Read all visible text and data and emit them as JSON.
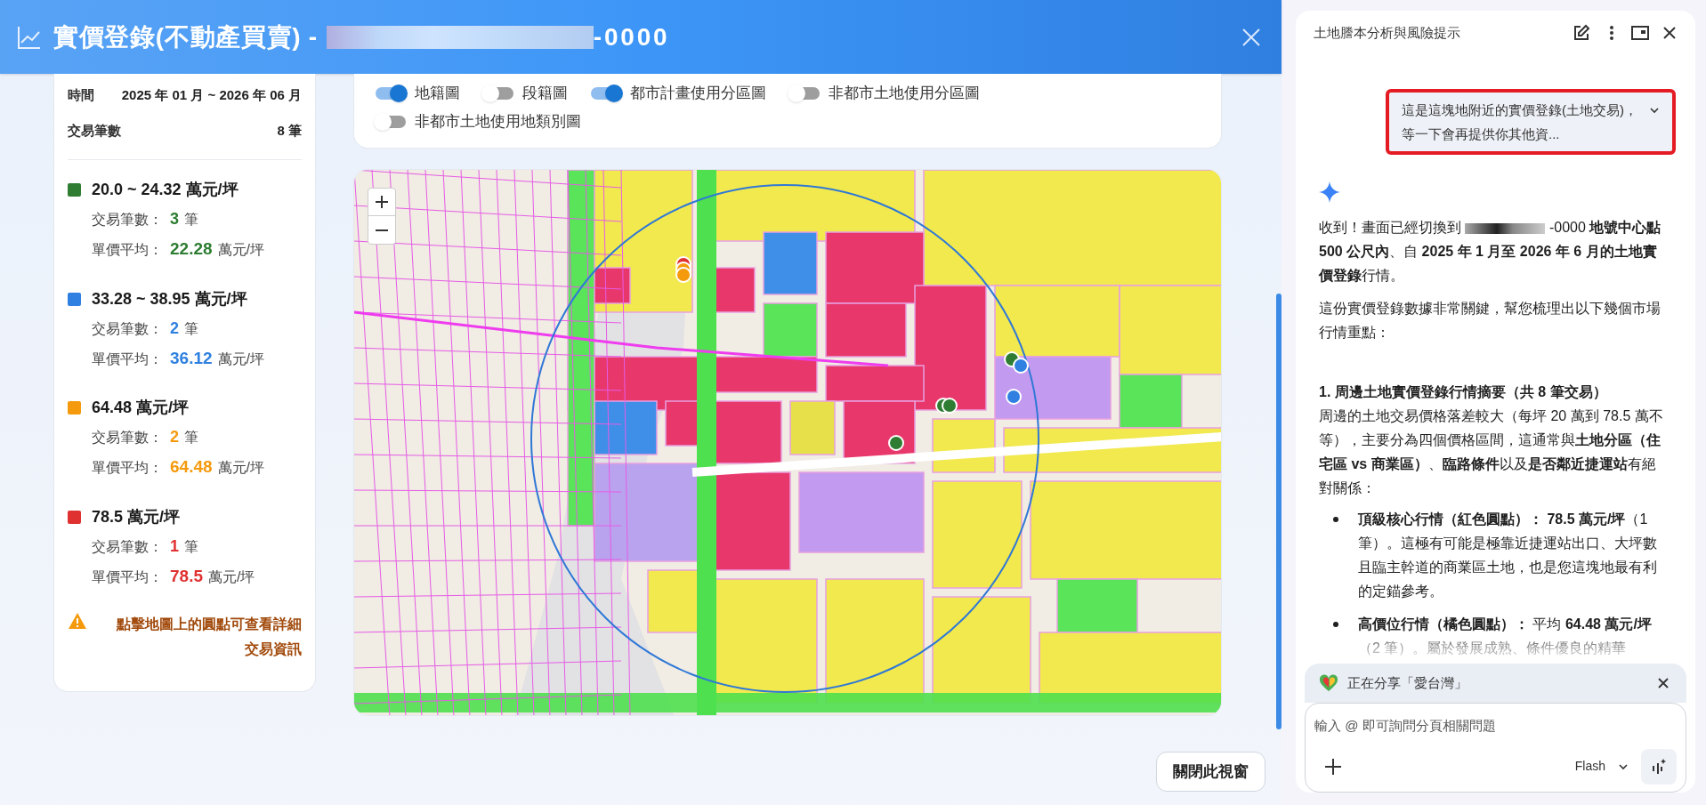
{
  "header": {
    "title": "實價登錄(不動產買賣) -",
    "title_suffix": "-0000"
  },
  "summary": [
    {
      "label": "時間",
      "value": "2025 年 01 月 ~ 2026 年 06 月"
    },
    {
      "label": "交易筆數",
      "value": "8 筆"
    }
  ],
  "legend": [
    {
      "color": "#2e7d32",
      "range": "20.0 ~ 24.32 萬元/坪",
      "count_label": "交易筆數：",
      "count": "3",
      "count_unit": "筆",
      "avg_label": "單價平均：",
      "avg": "22.28",
      "avg_unit": "萬元/坪"
    },
    {
      "color": "#2f80e0",
      "range": "33.28 ~ 38.95 萬元/坪",
      "count_label": "交易筆數：",
      "count": "2",
      "count_unit": "筆",
      "avg_label": "單價平均：",
      "avg": "36.12",
      "avg_unit": "萬元/坪"
    },
    {
      "color": "#f59a0c",
      "range": "64.48 萬元/坪",
      "count_label": "交易筆數：",
      "count": "2",
      "count_unit": "筆",
      "avg_label": "單價平均：",
      "avg": "64.48",
      "avg_unit": "萬元/坪"
    },
    {
      "color": "#e03131",
      "range": "78.5 萬元/坪",
      "count_label": "交易筆數：",
      "count": "1",
      "count_unit": "筆",
      "avg_label": "單價平均：",
      "avg": "78.5",
      "avg_unit": "萬元/坪"
    }
  ],
  "hint": "點擊地圖上的圓點可查看詳細交易資訊",
  "layers": [
    {
      "label": "地籍圖",
      "on": true
    },
    {
      "label": "段籍圖",
      "on": false
    },
    {
      "label": "都市計畫使用分區圖",
      "on": true
    },
    {
      "label": "非都市土地使用分區圖",
      "on": false
    },
    {
      "label": "非都市土地使用地類別圖",
      "on": false
    }
  ],
  "close_button": "關閉此視窗",
  "assistant": {
    "title": "土地謄本分析與風險提示",
    "user_message": "這是這塊地附近的實價登錄(土地交易)，等一下會再提供你其他資...",
    "intro_before": "收到！畫面已經切換到",
    "intro_after": "-0000 **地號中心點 500 公尺內**、自 **2025 年 1 月至 2026 年 6 月的土地實價登錄**行情。",
    "paragraph": "這份實價登錄數據非常關鍵，幫您梳理出以下幾個市場行情重點：",
    "section_heading": "1. 周邊土地實價登錄行情摘要（共 8 筆交易）",
    "section_text": "周邊的土地交易價格落差較大（每坪 20 萬到 78.5 萬不等），主要分為四個價格區間，這通常與**土地分區（住宅區 vs 商業區）**、**臨路條件**以及**是否鄰近捷運站**有絕對關係：",
    "bullets": [
      "**頂級核心行情（紅色圓點）： 78.5 萬元/坪**（1 筆）。這極有可能是極靠近捷運站出口、大坪數且臨主幹道的商業區土地，也是您這塊地最有利的定錨參考。",
      "**高價位行情（橘色圓點）：** 平均 **64.48 萬元/坪**（2 筆）。屬於發展成熟、條件優良的精華"
    ],
    "sharing": "正在分享「愛台灣」",
    "input_placeholder": "輸入 @ 即可詢問分頁相關問題",
    "model": "Flash"
  }
}
